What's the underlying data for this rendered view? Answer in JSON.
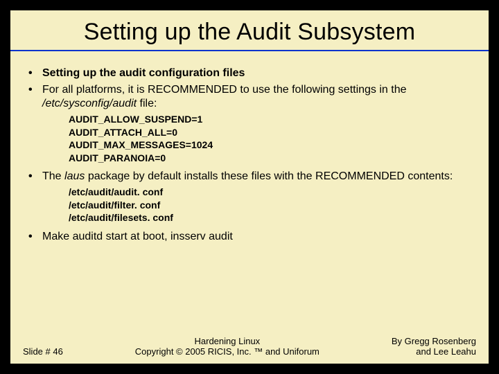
{
  "slide": {
    "title": "Setting up the Audit Subsystem",
    "bullets": [
      {
        "text": "Setting up the audit configuration files"
      },
      {
        "prefix": "For all platforms, it is RECOMMENDED to use the following settings in the ",
        "em": "/etc/sysconfig/audit",
        "suffix": " file:",
        "sub": [
          "AUDIT_ALLOW_SUSPEND=1",
          "AUDIT_ATTACH_ALL=0",
          "AUDIT_MAX_MESSAGES=1024",
          "AUDIT_PARANOIA=0"
        ]
      },
      {
        "prefix": "The ",
        "em": "laus",
        "suffix": " package by default installs these files with the RECOMMENDED contents:",
        "sub": [
          "/etc/audit/audit. conf",
          "/etc/audit/filter. conf",
          "/etc/audit/filesets. conf"
        ]
      },
      {
        "text": "Make auditd start at boot, insserv audit"
      }
    ],
    "footer": {
      "left": "Slide # 46",
      "center_line1": "Hardening Linux",
      "center_line2": "Copyright © 2005 RICIS, Inc. ™ and Uniforum",
      "right_line1": "By Gregg Rosenberg",
      "right_line2": "and Lee Leahu"
    }
  }
}
